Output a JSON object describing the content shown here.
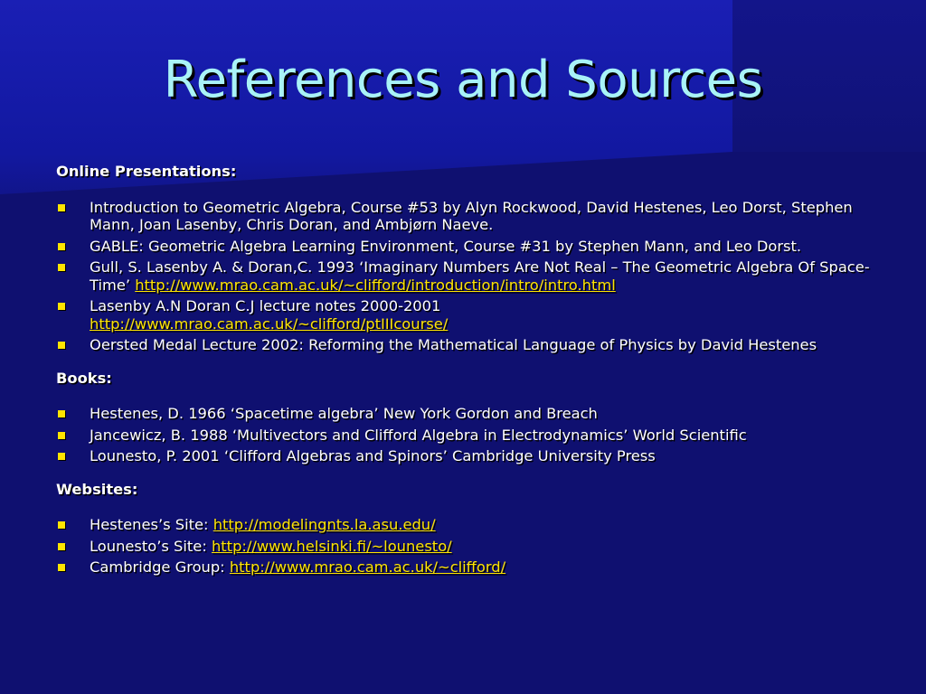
{
  "slide": {
    "title": "References and Sources",
    "colors": {
      "background": "#0f1070",
      "title": "#a9f3f7",
      "bullet": "#ffe500",
      "link": "#ffe500",
      "text": "#ffffff"
    },
    "sections": {
      "online": {
        "heading": "Online Presentations:",
        "items": [
          {
            "text": "Introduction to Geometric Algebra, Course #53 by Alyn Rockwood, David Hestenes, Leo Dorst, Stephen Mann, Joan Lasenby, Chris Doran, and Ambjørn Naeve."
          },
          {
            "text": "GABLE: Geometric Algebra Learning Environment, Course #31 by Stephen Mann, and Leo Dorst."
          },
          {
            "text": "Gull, S. Lasenby A. & Doran,C. 1993    ‘Imaginary Numbers Are Not Real – The Geometric Algebra Of Space-Time’ ",
            "link": "http://www.mrao.cam.ac.uk/~clifford/introduction/intro/intro.html"
          },
          {
            "text": "Lasenby A.N Doran C.J  lecture notes 2000-2001",
            "link": "http://www.mrao.cam.ac.uk/~clifford/ptIIIcourse/"
          },
          {
            "text": "Oersted Medal Lecture 2002:  Reforming the Mathematical Language of Physics by David Hestenes"
          }
        ]
      },
      "books": {
        "heading": "Books:",
        "items": [
          {
            "text": "Hestenes, D. 1966 ‘Spacetime algebra’ New York Gordon and Breach"
          },
          {
            "text": "Jancewicz, B. 1988 ‘Multivectors and Clifford Algebra in Electrodynamics’ World Scientific"
          },
          {
            "text": "Lounesto, P. 2001 ‘Clifford Algebras and Spinors’ Cambridge University Press"
          }
        ]
      },
      "websites": {
        "heading": "Websites:",
        "items": [
          {
            "text": "Hestenes’s Site: ",
            "link": "http://modelingnts.la.asu.edu/"
          },
          {
            "text": "Lounesto’s Site: ",
            "link": "http://www.helsinki.fi/~lounesto/"
          },
          {
            "text": "Cambridge Group: ",
            "link": "http://www.mrao.cam.ac.uk/~clifford/"
          }
        ]
      }
    }
  }
}
